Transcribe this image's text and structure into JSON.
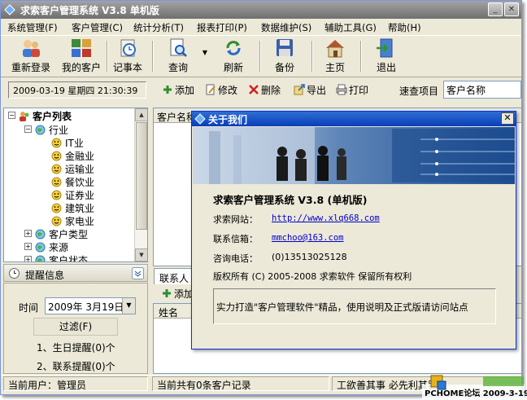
{
  "window": {
    "title": "求索客户管理系统 V3.8 单机版"
  },
  "menu": [
    "系统管理(F)",
    "客户管理(C)",
    "统计分析(T)",
    "报表打印(P)",
    "数据维护(S)",
    "辅助工具(G)",
    "帮助(H)"
  ],
  "toolbar": {
    "relogin": "重新登录",
    "my_customers": "我的客户",
    "notebook": "记事本",
    "query": "查询",
    "refresh": "刷新",
    "backup": "备份",
    "home": "主页",
    "exit": "退出"
  },
  "subbar": {
    "datetime": "2009-03-19 星期四 21:30:39",
    "add": "添加",
    "edit": "修改",
    "delete": "删除",
    "export": "导出",
    "print": "打印",
    "quick_search_label": "速查项目",
    "quick_search_value": "客户名称"
  },
  "tree": {
    "root": "客户列表",
    "industry": "行业",
    "industries": [
      "IT业",
      "金融业",
      "运输业",
      "餐饮业",
      "证券业",
      "建筑业",
      "家电业"
    ],
    "customer_type": "客户类型",
    "source": "来源",
    "status": "客户状态"
  },
  "reminder": {
    "title": "提醒信息",
    "time_label": "时间",
    "date_value": "2009年 3月19日",
    "filter_label": "过滤(F)",
    "birthday": "1、生日提醒(0)个",
    "contact": "2、联系提醒(0)个"
  },
  "grid": {
    "column_customer_name": "客户名称"
  },
  "contacts": {
    "tab": "联系人",
    "add": "添加",
    "column_name": "姓名"
  },
  "status": {
    "user": "当前用户：管理员",
    "records": "当前共有0条客户记录",
    "motto": "工欲善其事 必先利其器"
  },
  "about": {
    "title": "关于我们",
    "product": "求索客户管理系统 V3.8 (单机版)",
    "website_label": "求索网站：",
    "website": "http://www.xlq668.com",
    "email_label": "联系信箱：",
    "email": "mmchoo@163.com",
    "phone_label": "咨询电话：",
    "phone": "(0)13513025128",
    "copyright": "版权所有 (C) 2005-2008  求索软件  保留所有权利",
    "slogan": "实力打造\"客户管理软件\"精品，使用说明及正式版请访问站点"
  },
  "watermark": {
    "text": "PCHOME论坛 2009-3-19"
  },
  "colors": {
    "dialog_title": "#0a3eb9",
    "main_title": "#6f6f6f",
    "link": "#0000cc"
  }
}
